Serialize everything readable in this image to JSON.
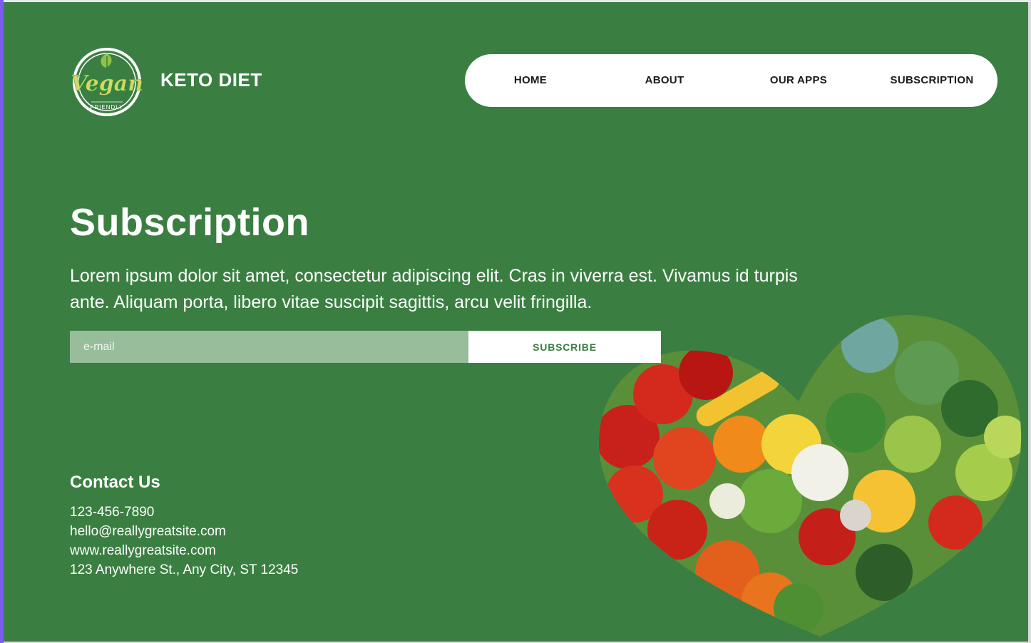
{
  "header": {
    "logo_text": "Vegan",
    "logo_subtext": "FRIENDLY",
    "brand": "KETO DIET"
  },
  "nav": {
    "items": [
      {
        "label": "HOME"
      },
      {
        "label": "ABOUT"
      },
      {
        "label": "OUR APPS"
      },
      {
        "label": "SUBSCRIPTION"
      }
    ]
  },
  "hero": {
    "title": "Subscription",
    "description": "Lorem ipsum dolor sit amet, consectetur adipiscing elit. Cras in viverra est. Vivamus id turpis ante. Aliquam porta, libero vitae suscipit sagittis, arcu velit fringilla."
  },
  "form": {
    "email_placeholder": "e-mail",
    "email_value": "",
    "subscribe_label": "SUBSCRIBE"
  },
  "contact": {
    "title": "Contact Us",
    "phone": "123-456-7890",
    "email": "hello@reallygreatsite.com",
    "website": "www.reallygreatsite.com",
    "address": "123 Anywhere St., Any City, ST 12345"
  },
  "colors": {
    "background": "#3a7f41",
    "input_bg": "#97bd9b",
    "accent": "#3a7f41"
  },
  "icons": {
    "logo": "vegan-friendly-badge-icon",
    "image": "vegetable-heart-image"
  }
}
